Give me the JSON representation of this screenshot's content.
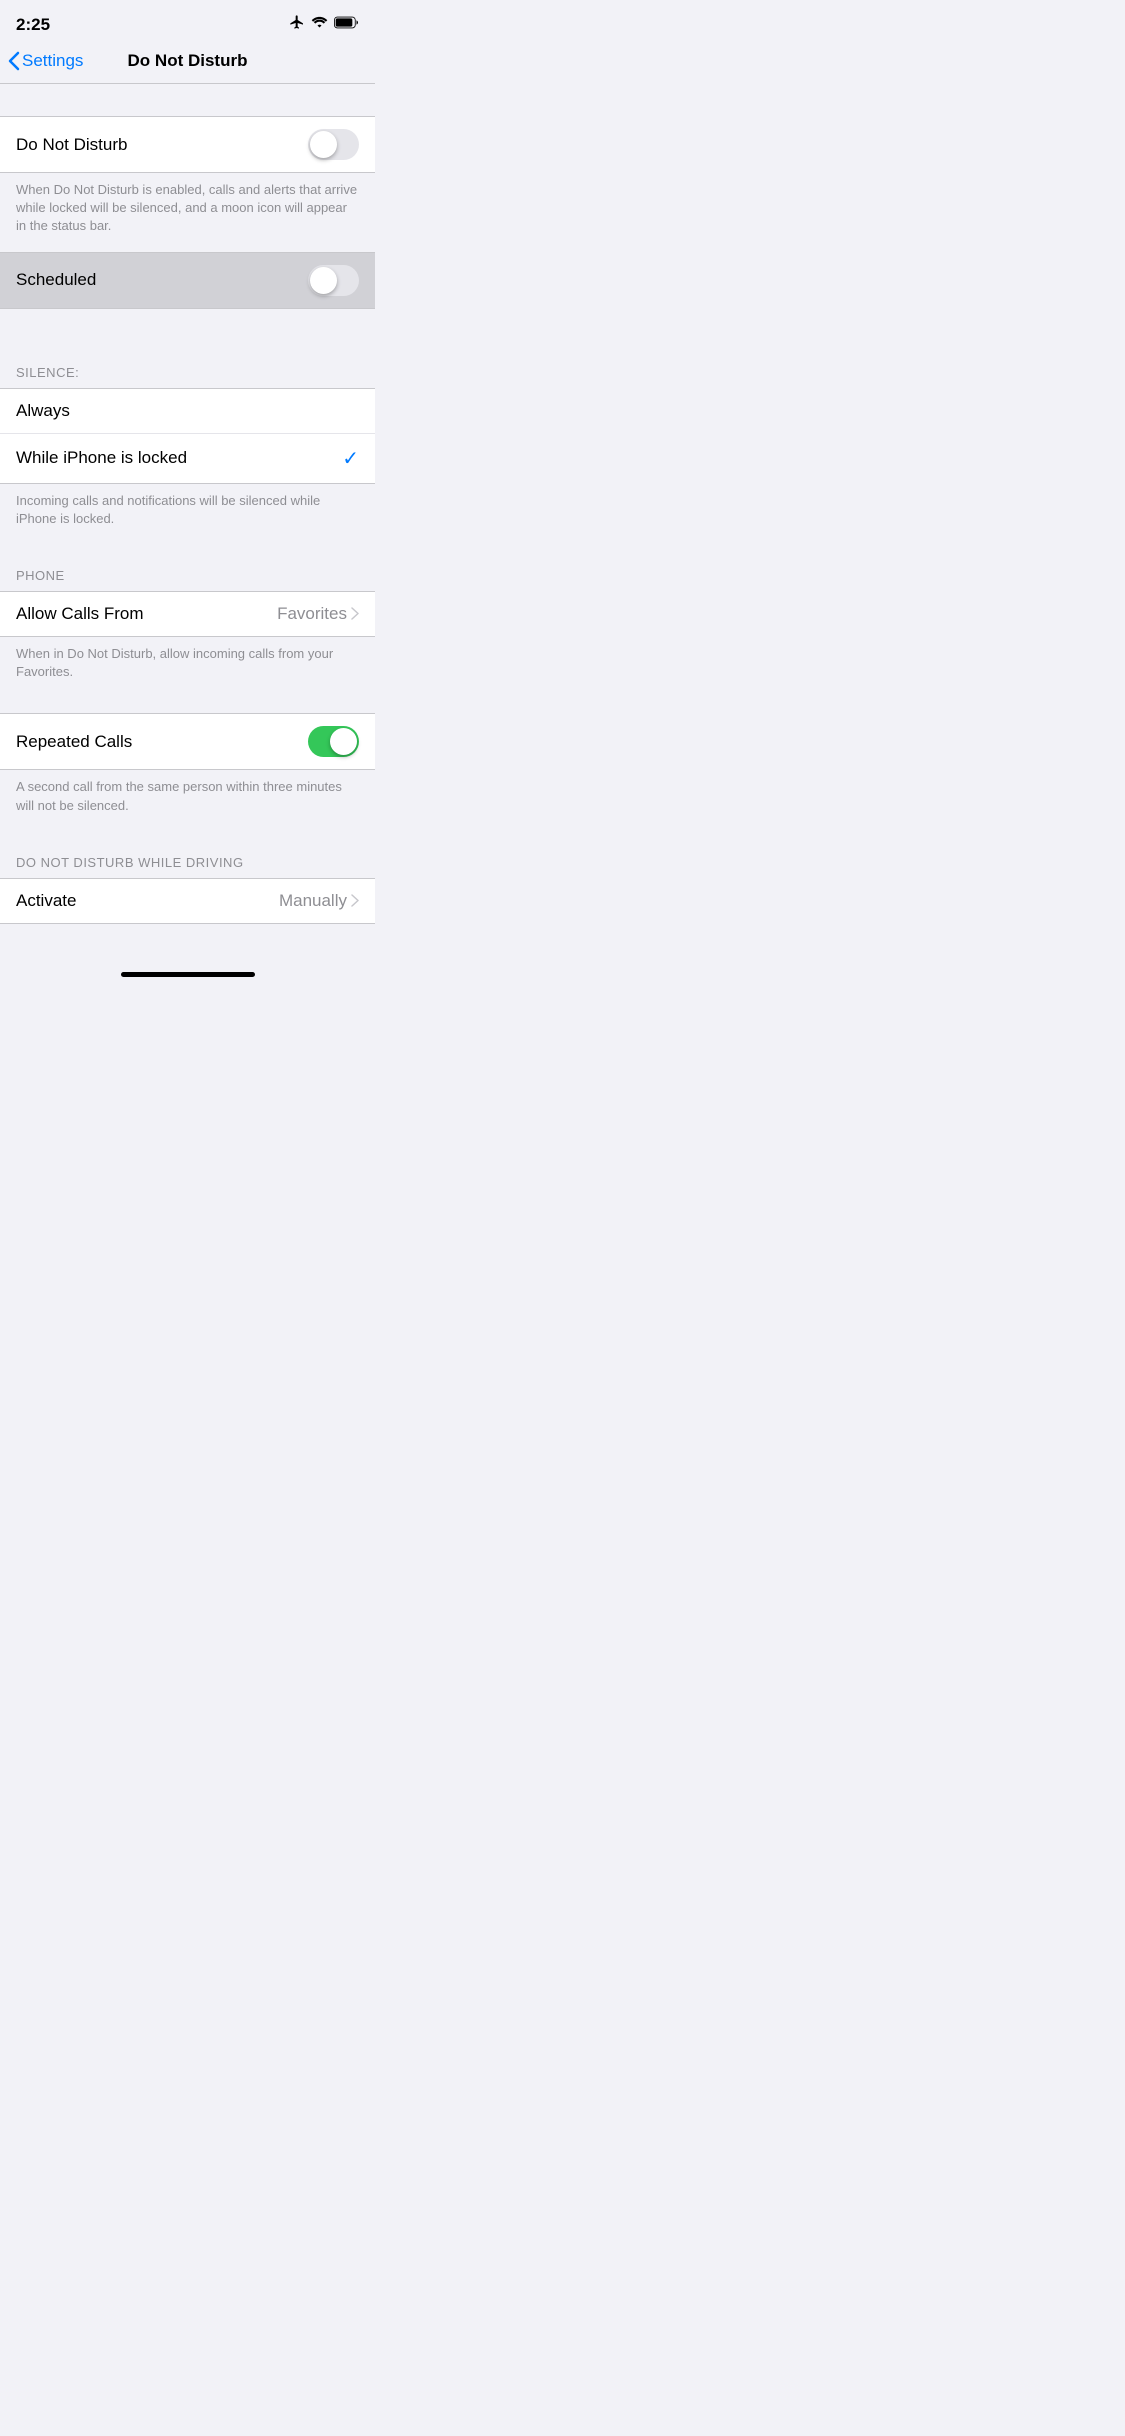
{
  "statusBar": {
    "time": "2:25"
  },
  "navBar": {
    "backLabel": "Settings",
    "title": "Do Not Disturb"
  },
  "doNotDisturbRow": {
    "label": "Do Not Disturb",
    "toggleOn": false
  },
  "doNotDisturbFooter": "When Do Not Disturb is enabled, calls and alerts that arrive while locked will be silenced, and a moon icon will appear in the status bar.",
  "scheduledRow": {
    "label": "Scheduled",
    "toggleOn": false
  },
  "silenceSection": {
    "header": "SILENCE:",
    "rows": [
      {
        "label": "Always",
        "checked": false
      },
      {
        "label": "While iPhone is locked",
        "checked": true
      }
    ],
    "footer": "Incoming calls and notifications will be silenced while iPhone is locked."
  },
  "phoneSection": {
    "header": "PHONE",
    "allowCallsRow": {
      "label": "Allow Calls From",
      "value": "Favorites"
    },
    "allowCallsFooter": "When in Do Not Disturb, allow incoming calls from your Favorites.",
    "repeatedCallsRow": {
      "label": "Repeated Calls",
      "toggleOn": true
    },
    "repeatedCallsFooter": "A second call from the same person within three minutes will not be silenced."
  },
  "drivingSection": {
    "header": "DO NOT DISTURB WHILE DRIVING",
    "activateRow": {
      "label": "Activate",
      "value": "Manually"
    }
  }
}
